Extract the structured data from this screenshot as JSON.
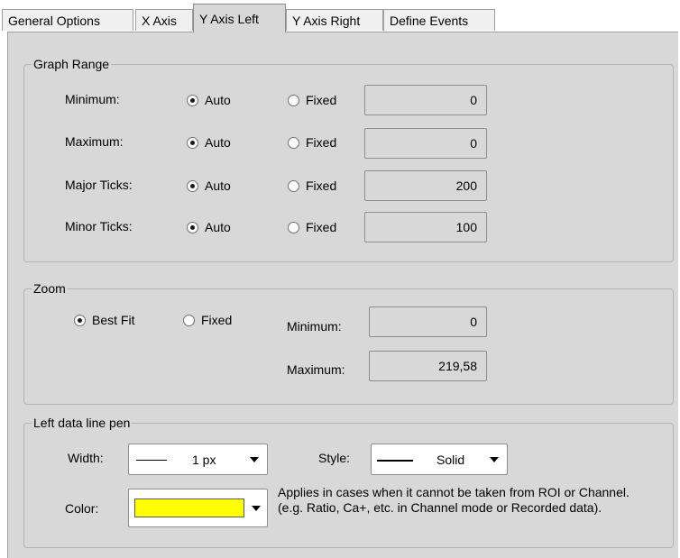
{
  "tabs": [
    {
      "label": "General Options"
    },
    {
      "label": "X Axis"
    },
    {
      "label": "Y Axis Left"
    },
    {
      "label": "Y Axis Right"
    },
    {
      "label": "Define Events"
    }
  ],
  "active_tab": "Y Axis Left",
  "graph_range": {
    "title": "Graph Range",
    "auto_label": "Auto",
    "fixed_label": "Fixed",
    "rows": [
      {
        "label": "Minimum:",
        "selected": "Auto",
        "value": "0"
      },
      {
        "label": "Maximum:",
        "selected": "Auto",
        "value": "0"
      },
      {
        "label": "Major Ticks:",
        "selected": "Auto",
        "value": "200"
      },
      {
        "label": "Minor Ticks:",
        "selected": "Auto",
        "value": "100"
      }
    ]
  },
  "zoom": {
    "title": "Zoom",
    "best_fit_label": "Best Fit",
    "fixed_label": "Fixed",
    "selected": "Best Fit",
    "minimum_label": "Minimum:",
    "minimum_value": "0",
    "maximum_label": "Maximum:",
    "maximum_value": "219,58"
  },
  "pen": {
    "title": "Left data line pen",
    "width_label": "Width:",
    "width_value": "1 px",
    "style_label": "Style:",
    "style_value": "Solid",
    "color_label": "Color:",
    "color_value": "#ffff00",
    "note": "Applies in cases when it cannot be taken from ROI or Channel. (e.g. Ratio, Ca+, etc. in Channel mode or Recorded data)."
  },
  "colors": {
    "panel_background": "#d8d8d8",
    "pen_color": "#ffff00"
  }
}
